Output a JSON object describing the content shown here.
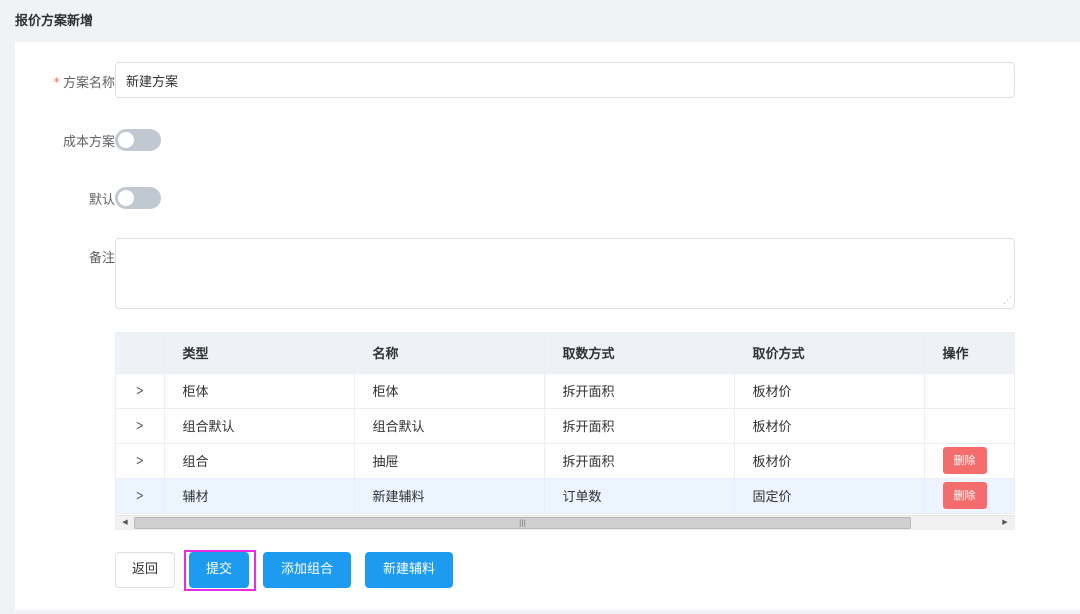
{
  "page": {
    "title": "报价方案新增"
  },
  "form": {
    "name_label": "方案名称",
    "name_required_mark": "*",
    "name_value": "新建方案",
    "cost_label": "成本方案",
    "default_label": "默认",
    "remark_label": "备注",
    "remark_value": ""
  },
  "table": {
    "headers": [
      "类型",
      "名称",
      "取数方式",
      "取价方式",
      "操作"
    ],
    "rows": [
      {
        "type": "柜体",
        "name": "柜体",
        "fetch": "拆开面积",
        "price": "板材价",
        "action": ""
      },
      {
        "type": "组合默认",
        "name": "组合默认",
        "fetch": "拆开面积",
        "price": "板材价",
        "action": ""
      },
      {
        "type": "组合",
        "name": "抽屉",
        "fetch": "拆开面积",
        "price": "板材价",
        "action": "删除"
      },
      {
        "type": "辅材",
        "name": "新建辅料",
        "fetch": "订单数",
        "price": "固定价",
        "action": "删除"
      }
    ]
  },
  "buttons": {
    "back": "返回",
    "submit": "提交",
    "add_group": "添加组合",
    "new_material": "新建辅料"
  },
  "colors": {
    "primary": "#1d9bf0",
    "danger": "#f56c6c",
    "focus": "#e62ee0"
  }
}
